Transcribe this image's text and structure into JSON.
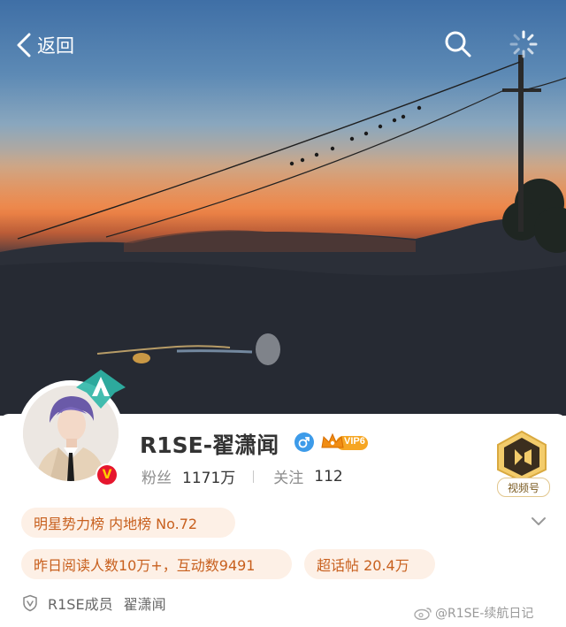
{
  "topbar": {
    "back_label": "返回"
  },
  "profile": {
    "username": "R1SE-翟潇闻",
    "vip_level": "VIP6",
    "verified_mark": "V",
    "fans_label": "粉丝",
    "fans_count": "1171万",
    "following_label": "关注",
    "following_count": "112",
    "video_account_label": "视频号"
  },
  "tags": {
    "rank": "明星势力榜 内地榜 No.72",
    "reads": "昨日阅读人数10万+，互动数9491",
    "topic_posts": "超话帖 20.4万"
  },
  "member": {
    "group": "R1SE成员",
    "name": "翟潇闻"
  },
  "watermark": {
    "text": "@R1SE-续航日记"
  },
  "colors": {
    "tag_bg": "#fdf0e6",
    "tag_text": "#c8601e",
    "gender_blue": "#3d9be9",
    "vip_gold": "#f6a623",
    "verify_red": "#e6162d"
  }
}
